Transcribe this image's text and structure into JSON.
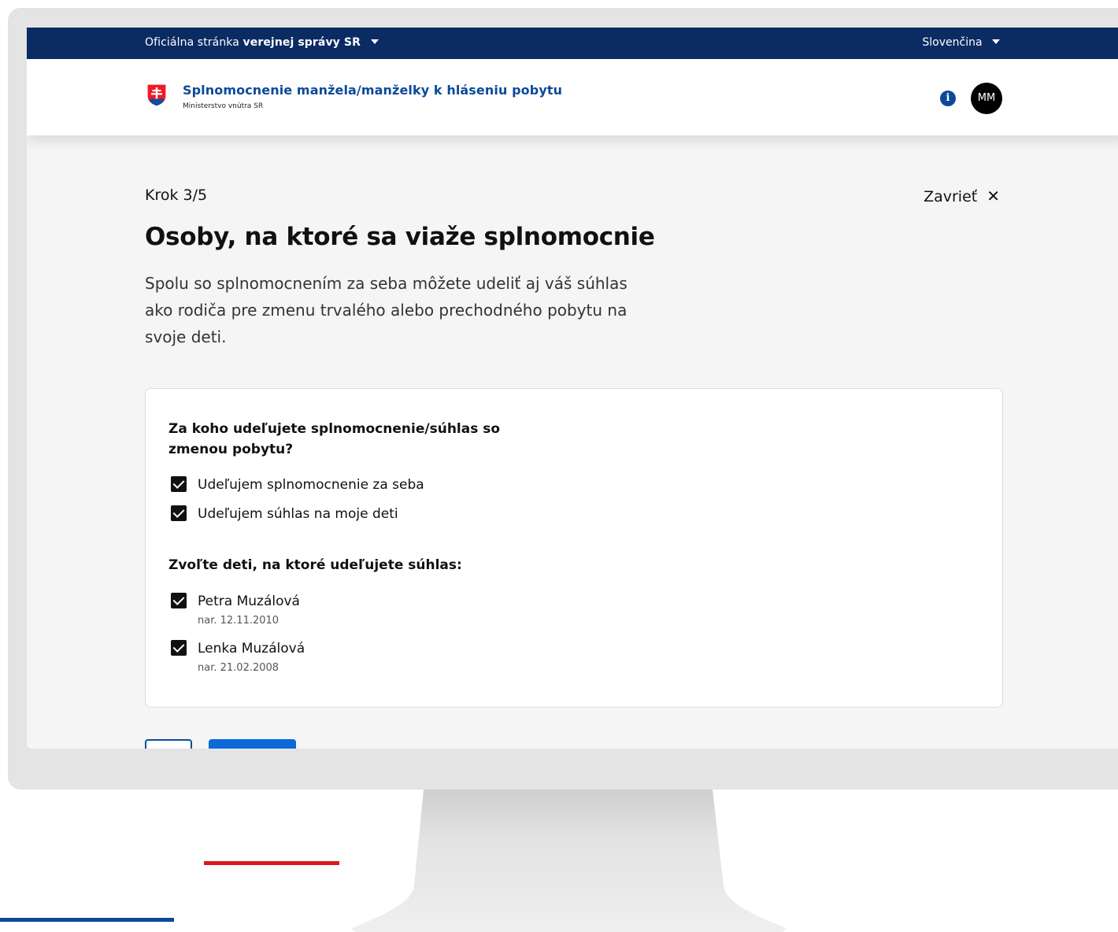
{
  "gov_bar": {
    "label_prefix": "Oficiálna stránka",
    "label_strong": "verejnej správy SR",
    "language": "Slovenčina"
  },
  "header": {
    "title": "Splnomocnenie manžela/manželky k hláseniu pobytu",
    "subtitle": "Ministerstvo vnútra SR",
    "info_glyph": "i",
    "avatar_initials": "MM"
  },
  "step": {
    "label": "Krok 3/5"
  },
  "close": {
    "label": "Zavrieť",
    "glyph": "✕"
  },
  "page": {
    "title": "Osoby, na ktoré sa viaže splnomocnie",
    "lead": "Spolu so splnomocnením za seba môžete udeliť aj váš súhlas ako rodiča pre zmenu trvalého alebo prechodného pobytu na svoje deti."
  },
  "form": {
    "question": "Za koho udeľujete splnomocnenie/súhlas so zmenou pobytu?",
    "options": [
      {
        "label": "Udeľujem splnomocnenie za seba",
        "checked": true
      },
      {
        "label": "Udeľujem súhlas na moje deti",
        "checked": true
      }
    ],
    "children_question": "Zvoľte deti, na ktoré udeľujete súhlas:",
    "children": [
      {
        "name": "Petra Muzálová",
        "dob": "nar. 12.11.2010",
        "checked": true
      },
      {
        "name": "Lenka Muzálová",
        "dob": "nar. 21.02.2008",
        "checked": true
      }
    ]
  },
  "icons": {
    "crest": "slovak-coat-of-arms-icon",
    "info": "info-icon",
    "close": "close-icon",
    "checkbox": "checkbox-checked-icon"
  },
  "colors": {
    "gov_bar": "#0b2b63",
    "brand_blue": "#0b4a99",
    "primary_button": "#0b6ad8",
    "accent_red": "#d71b1f"
  }
}
